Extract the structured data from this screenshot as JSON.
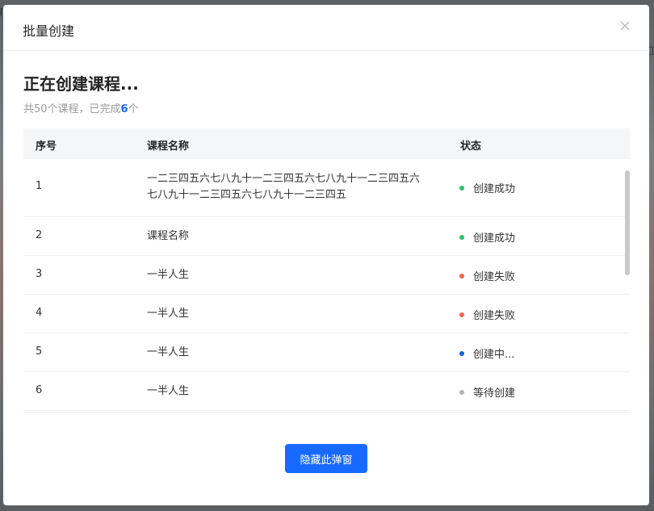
{
  "modal": {
    "title": "批量创建",
    "heading": "正在创建课程...",
    "summary_prefix": "共50个课程，已完成",
    "summary_count": "6",
    "summary_suffix": "个",
    "hide_button_label": "隐藏此弹窗"
  },
  "table": {
    "columns": [
      "序号",
      "课程名称",
      "状态"
    ],
    "rows": [
      {
        "index": "1",
        "name": "一二三四五六七八九十一二三四五六七八九十一二三四五六七八九十一二三四五六七八九十一二三四五",
        "status": "创建成功",
        "status_color": "#2ec26a"
      },
      {
        "index": "2",
        "name": "课程名称",
        "status": "创建成功",
        "status_color": "#2ec26a"
      },
      {
        "index": "3",
        "name": "一半人生",
        "status": "创建失败",
        "status_color": "#f0624d"
      },
      {
        "index": "4",
        "name": "一半人生",
        "status": "创建失败",
        "status_color": "#f0624d"
      },
      {
        "index": "5",
        "name": "一半人生",
        "status": "创建中...",
        "status_color": "#1a5fd8"
      },
      {
        "index": "6",
        "name": "一半人生",
        "status": "等待创建",
        "status_color": "#b3b3b3"
      }
    ]
  },
  "icons": {
    "close": "close-icon"
  },
  "colors": {
    "primary": "#1769ff",
    "success": "#2ec26a",
    "failure": "#f0624d",
    "in_progress": "#1a5fd8",
    "waiting": "#b3b3b3"
  }
}
